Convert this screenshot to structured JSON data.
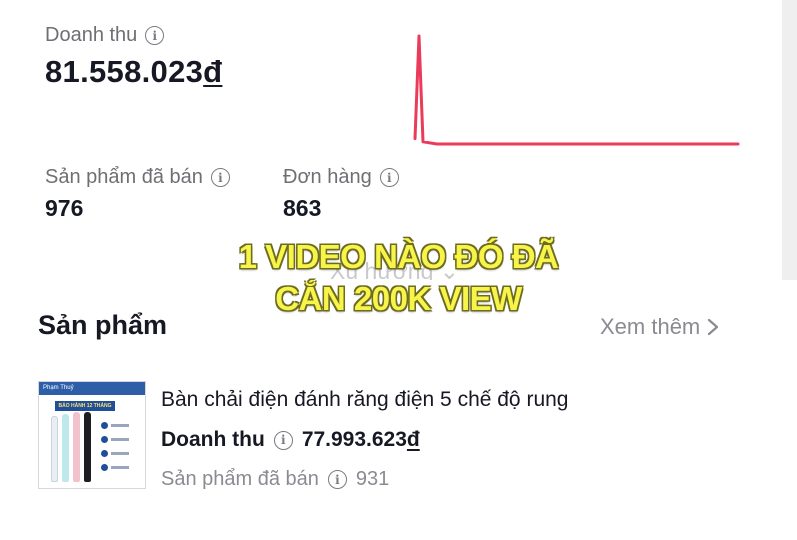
{
  "stats": {
    "revenue": {
      "label": "Doanh thu",
      "amount": "81.558.023",
      "currency": "đ"
    },
    "products_sold": {
      "label": "Sản phẩm đã bán",
      "value": "976"
    },
    "orders": {
      "label": "Đơn hàng",
      "value": "863"
    },
    "info_glyph": "i"
  },
  "trend_chart": {
    "type": "line",
    "color": "#ea3b5a",
    "y_levels": [
      0.05,
      1.0,
      0.02,
      0.0,
      0.0,
      0.0,
      0.0,
      0.0,
      0.0,
      0.0,
      0.0,
      0.0,
      0.0,
      0.0,
      0.0,
      0.0,
      0.0,
      0.0,
      0.0,
      0.0,
      0.0,
      0.0,
      0.0,
      0.0,
      0.0,
      0.0,
      0.0,
      0.0,
      0.0,
      0.0
    ]
  },
  "faded_link": {
    "text": "Xu hướng"
  },
  "products": {
    "title": "Sản phẩm",
    "see_more": "Xem thêm",
    "see_more_icon": "chevron-right-icon",
    "items": [
      {
        "name": "Bàn chải điện đánh răng điện 5 chế độ rung",
        "revenue_label": "Doanh thu",
        "revenue_amount": "77.993.623",
        "revenue_currency": "đ",
        "sold_label": "Sản phẩm đã bán",
        "sold_value": "931",
        "thumbnail": {
          "brand_text": "Phạm Thuỷ",
          "banner_text": "BẢO HÀNH 12 THÁNG"
        }
      }
    ]
  },
  "overlay_caption": {
    "line1": "1 VIDEO NÀO ĐÓ ĐÃ",
    "line2": "CẮN 200K VIEW",
    "color": "#f8f54a"
  }
}
